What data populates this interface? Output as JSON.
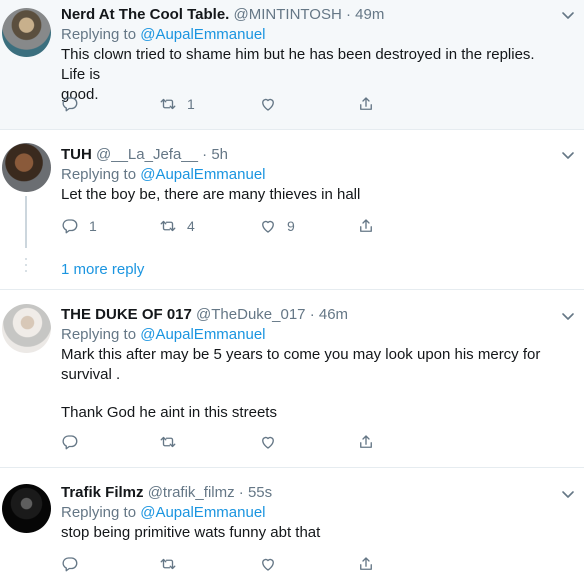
{
  "tweets": [
    {
      "name": "Nerd At The Cool Table.",
      "handle": "@MINTINTOSH",
      "sep": "·",
      "time": "49m",
      "replying_prefix": "Replying to",
      "replying_to": "@AupalEmmanuel",
      "text_lines": [
        "This clown tried to shame him but he has been destroyed in the replies. Life is",
        "good."
      ],
      "reply_count": "",
      "retweet_count": "1",
      "like_count": ""
    },
    {
      "name": "TUH",
      "handle": "@__La_Jefa__",
      "sep": "·",
      "time": "5h",
      "replying_prefix": "Replying to",
      "replying_to": "@AupalEmmanuel",
      "text_lines": [
        "Let the boy be, there are many thieves in hall"
      ],
      "reply_count": "1",
      "retweet_count": "4",
      "like_count": "9"
    },
    {
      "name": "THE DUKE OF 017",
      "handle": "@TheDuke_017",
      "sep": "·",
      "time": "46m",
      "replying_prefix": "Replying to",
      "replying_to": "@AupalEmmanuel",
      "text_lines": [
        "Mark this after may be 5 years to come you may look upon his mercy for",
        "survival .",
        "",
        "Thank God he aint in this streets"
      ],
      "reply_count": "",
      "retweet_count": "",
      "like_count": ""
    },
    {
      "name": "Trafik Filmz",
      "handle": "@trafik_filmz",
      "sep": "·",
      "time": "55s",
      "replying_prefix": "Replying to",
      "replying_to": "@AupalEmmanuel",
      "text_lines": [
        "stop being primitive wats funny abt that"
      ],
      "reply_count": "",
      "retweet_count": "",
      "like_count": ""
    }
  ],
  "thread": {
    "more_reply_label": "1 more reply"
  },
  "icons": {
    "reply": "reply-icon",
    "retweet": "retweet-icon",
    "like": "heart-icon",
    "share": "share-icon",
    "caret": "chevron-down-icon"
  },
  "colors": {
    "link": "#1b95e0",
    "muted": "#657786",
    "highlight_bg": "#f5f8fa",
    "divider": "#e6ecf0"
  }
}
